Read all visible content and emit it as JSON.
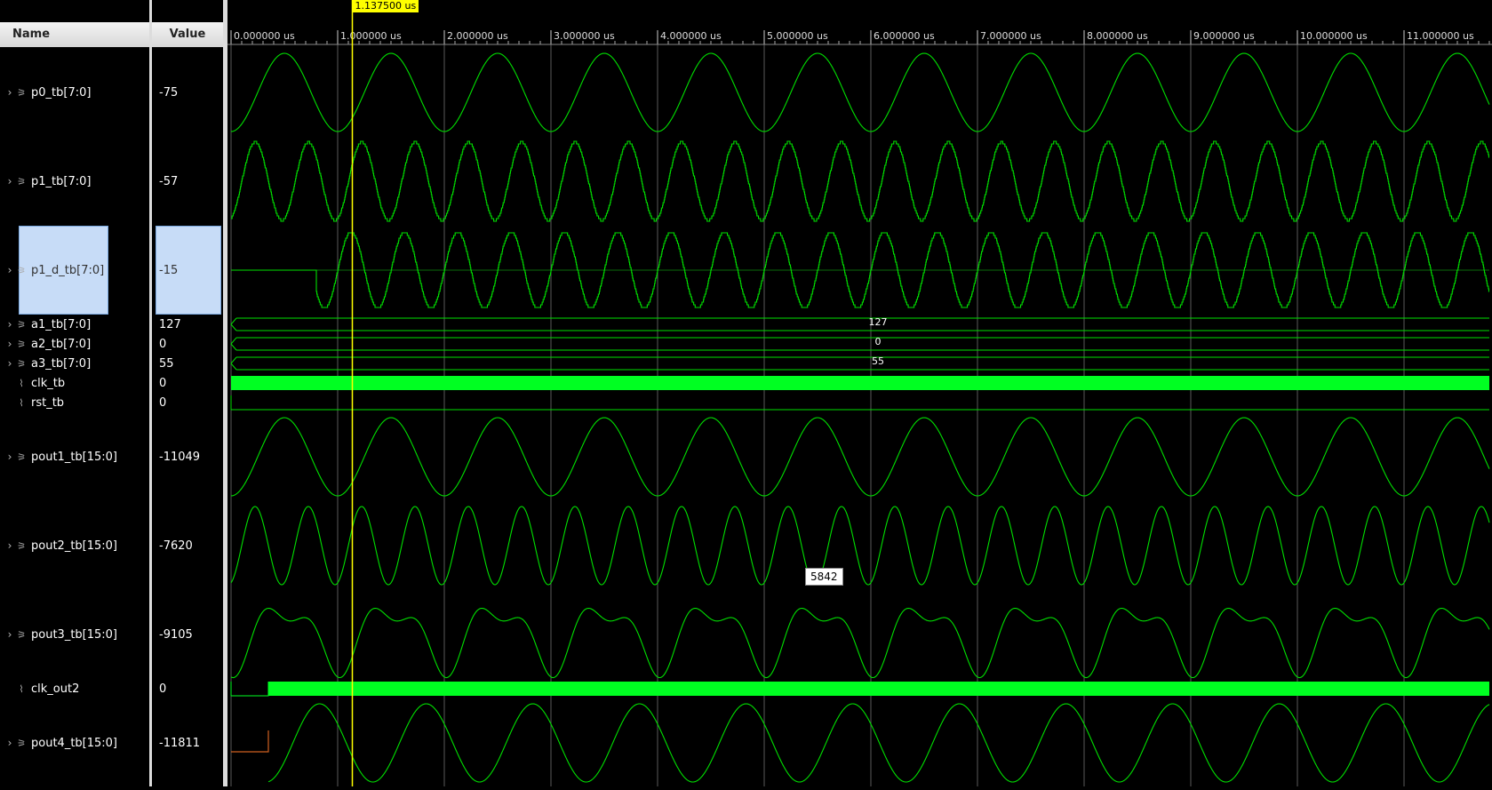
{
  "columns": {
    "name": "Name",
    "value": "Value"
  },
  "cursor": {
    "label": "1.137500 us",
    "time_us": 1.1375
  },
  "tooltip": {
    "text": "5842"
  },
  "timeline": {
    "ticks": [
      "0.000000 us",
      "1.000000 us",
      "2.000000 us",
      "3.000000 us",
      "4.000000 us",
      "5.000000 us",
      "6.000000 us",
      "7.000000 us",
      "8.000000 us",
      "9.000000 us",
      "10.000000 us",
      "11.000000 us"
    ],
    "visible_range_us": [
      0,
      11.8
    ]
  },
  "signals": [
    {
      "name": "p0_tb[7:0]",
      "value": "-75",
      "kind": "bus",
      "display": "analog"
    },
    {
      "name": "p1_tb[7:0]",
      "value": "-57",
      "kind": "bus",
      "display": "analog"
    },
    {
      "name": "p1_d_tb[7:0]",
      "value": "-15",
      "kind": "bus",
      "display": "analog",
      "selected": true
    },
    {
      "name": "a1_tb[7:0]",
      "value": "127",
      "kind": "bus",
      "display": "digital",
      "bus_label": "127"
    },
    {
      "name": "a2_tb[7:0]",
      "value": "0",
      "kind": "bus",
      "display": "digital",
      "bus_label": "0"
    },
    {
      "name": "a3_tb[7:0]",
      "value": "55",
      "kind": "bus",
      "display": "digital",
      "bus_label": "55"
    },
    {
      "name": "clk_tb",
      "value": "0",
      "kind": "wire",
      "display": "clock"
    },
    {
      "name": "rst_tb",
      "value": "0",
      "kind": "wire",
      "display": "low"
    },
    {
      "name": "pout1_tb[15:0]",
      "value": "-11049",
      "kind": "bus",
      "display": "analog"
    },
    {
      "name": "pout2_tb[15:0]",
      "value": "-7620",
      "kind": "bus",
      "display": "analog"
    },
    {
      "name": "pout3_tb[15:0]",
      "value": "-9105",
      "kind": "bus",
      "display": "analog"
    },
    {
      "name": "clk_out2",
      "value": "0",
      "kind": "wire",
      "display": "clock"
    },
    {
      "name": "pout4_tb[15:0]",
      "value": "-11811",
      "kind": "bus",
      "display": "analog"
    }
  ],
  "colors": {
    "wave": "#00e000",
    "clock": "#00ff22",
    "cursor": "#ffff00",
    "gridline": "#5a5a5a",
    "reset_stub": "#d06020",
    "selection": "#c7dcf7"
  },
  "icons": {
    "expand": "chevron-right-icon",
    "bus": "bus-signal-icon",
    "wire": "wire-signal-icon"
  }
}
